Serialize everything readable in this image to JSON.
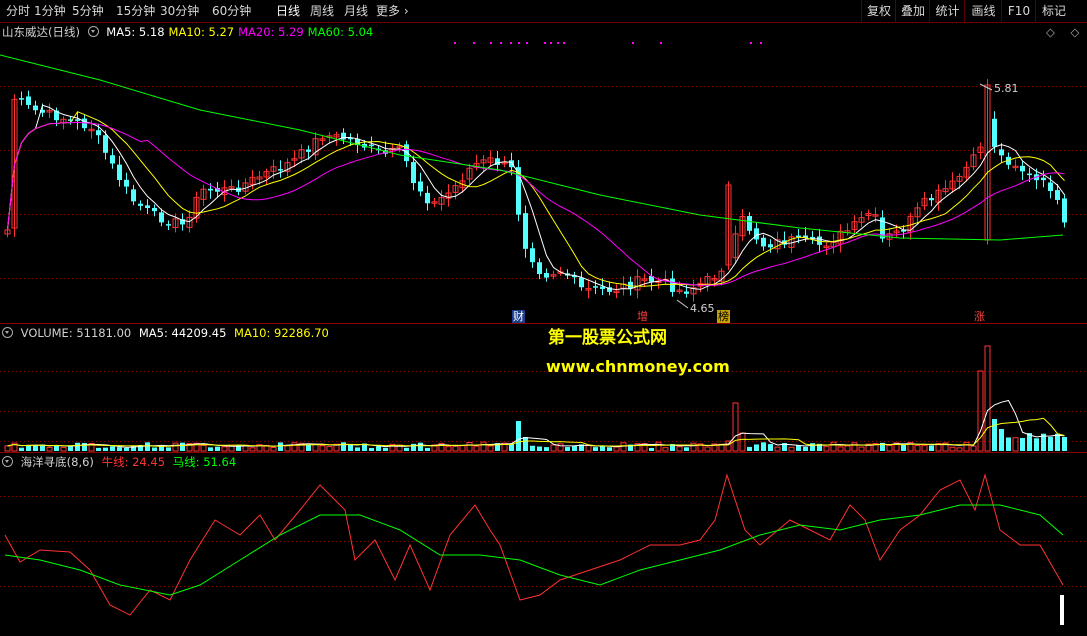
{
  "toolbar": {
    "periods": [
      "分时",
      "1分钟",
      "5分钟",
      "15分钟",
      "30分钟",
      "60分钟",
      "日线",
      "周线",
      "月线",
      "更多"
    ],
    "active_period": "日线",
    "right_buttons": [
      "复权",
      "叠加",
      "统计",
      "画线",
      "F10",
      "标记"
    ]
  },
  "main_panel": {
    "stock_name": "山东威达(日线)",
    "ma": [
      {
        "label": "MA5:",
        "value": "5.18",
        "color": "#ffffff"
      },
      {
        "label": "MA10:",
        "value": "5.27",
        "color": "#ffff00"
      },
      {
        "label": "MA20:",
        "value": "5.29",
        "color": "#ff00ff"
      },
      {
        "label": "MA60:",
        "value": "5.04",
        "color": "#00ff00"
      }
    ],
    "high_label": "5.81",
    "low_label": "4.65",
    "markers": [
      {
        "text": "财",
        "bg": "#1c3c8c",
        "color": "#ffffff"
      },
      {
        "text": "增",
        "bg": "#000000",
        "color": "#ff4040"
      },
      {
        "text": "榜",
        "bg": "#c8a000",
        "color": "#000000"
      },
      {
        "text": "涨",
        "bg": "#000000",
        "color": "#ff4040"
      }
    ],
    "right_icons": [
      "◇",
      "◇"
    ]
  },
  "volume_panel": {
    "label": "VOLUME:",
    "value": "51181.00",
    "ma5_label": "MA5:",
    "ma5_value": "44209.45",
    "ma10_label": "MA10:",
    "ma10_value": "92286.70"
  },
  "indicator_panel": {
    "name": "海洋寻底(8,6)",
    "bull_label": "牛线:",
    "bull_value": "24.45",
    "horse_label": "马线:",
    "horse_value": "51.64"
  },
  "watermark": {
    "title": "第一股票公式网",
    "url": "www.chnmoney.com"
  },
  "colors": {
    "up": "#ff3232",
    "down": "#54ffff",
    "ma5": "#ffffff",
    "ma10": "#ffff00",
    "ma20": "#ff00ff",
    "ma60": "#00ff00",
    "grid": "#8b0000"
  }
}
